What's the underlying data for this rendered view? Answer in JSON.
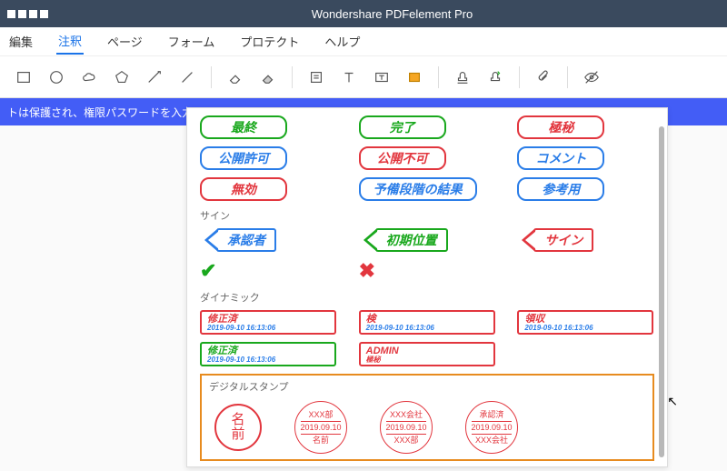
{
  "title": "Wondershare PDFelement Pro",
  "menu": [
    "編集",
    "注釈",
    "ページ",
    "フォーム",
    "プロテクト",
    "ヘルプ"
  ],
  "menu_active_index": 1,
  "banner": "トは保護され、権限パスワードを入力",
  "sections": {
    "sign": "サイン",
    "dynamic": "ダイナミック",
    "digital": "デジタルスタンプ"
  },
  "stamps": {
    "r1": [
      {
        "label": "最終",
        "c": "green"
      },
      {
        "label": "完了",
        "c": "green"
      },
      {
        "label": "極秘",
        "c": "red"
      }
    ],
    "r2": [
      {
        "label": "公開許可",
        "c": "blue"
      },
      {
        "label": "公開不可",
        "c": "red"
      },
      {
        "label": "コメント",
        "c": "blue"
      }
    ],
    "r3": [
      {
        "label": "無効",
        "c": "red"
      },
      {
        "label": "予備段階の結果",
        "c": "blue"
      },
      {
        "label": "参考用",
        "c": "blue"
      }
    ]
  },
  "arrows": [
    {
      "label": "承認者",
      "c": "blue"
    },
    {
      "label": "初期位置",
      "c": "green"
    },
    {
      "label": "サイン",
      "c": "red"
    }
  ],
  "marks": {
    "check": "✔",
    "cross": "✖"
  },
  "dynamic": {
    "r1": [
      {
        "t1": "修正済",
        "t2": "2019-09-10 16:13:06",
        "c": "red"
      },
      {
        "t1": "検",
        "t2": "2019-09-10 16:13:06",
        "c": "red"
      },
      {
        "t1": "領収",
        "t2": "2019-09-10 16:13:06",
        "c": "red"
      }
    ],
    "r2": [
      {
        "t1": "修正済",
        "t2": "2019-09-10 16:13:06",
        "c": "green"
      },
      {
        "t1": "ADMIN",
        "t3": "極秘",
        "c": "red",
        "admin": true
      }
    ]
  },
  "digital_stamps": [
    {
      "type": "simple",
      "line1": "名",
      "line2": "前"
    },
    {
      "type": "triple",
      "top": "XXX部",
      "mid": "2019.09.10",
      "bot": "名前"
    },
    {
      "type": "triple",
      "top": "XXX会社",
      "mid": "2019.09.10",
      "bot": "XXX部"
    },
    {
      "type": "triple",
      "top": "承認済",
      "mid": "2019.09.10",
      "bot": "XXX会社"
    }
  ]
}
